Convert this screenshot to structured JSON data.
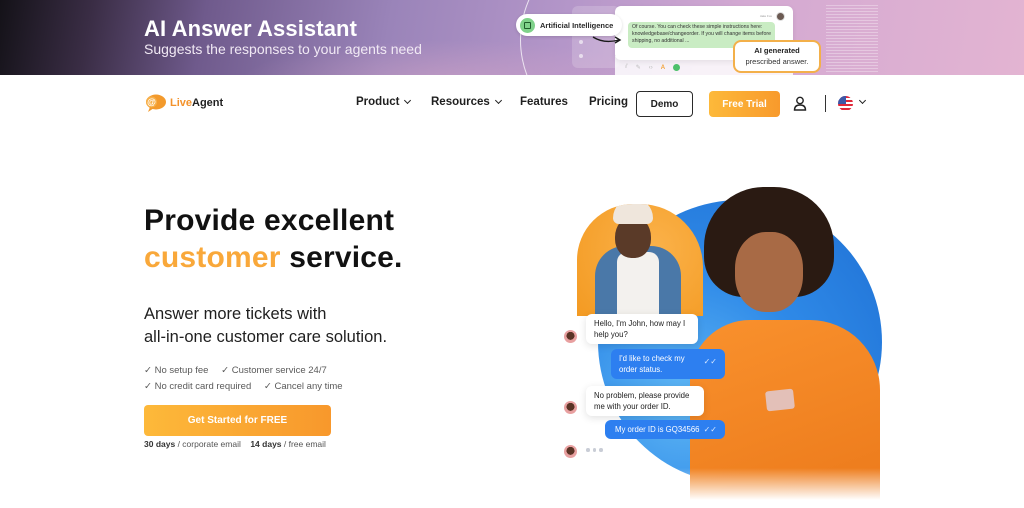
{
  "banner": {
    "title": "AI Answer Assistant",
    "subtitle": "Suggests the responses to your agents need",
    "ai_pill_label": "Artificial Intelligence",
    "chat_card": {
      "agent_name": "Jake Fox",
      "message": "Of course. You can check these simple instructions here: knowledgebase/changeorder. If you will change items before shipping, no additional ..."
    },
    "callout": {
      "title": "AI generated",
      "subtitle": "prescribed answer."
    }
  },
  "nav": {
    "logo_live": "Live",
    "logo_agent": "Agent",
    "items": [
      {
        "label": "Product",
        "has_dropdown": true
      },
      {
        "label": "Resources",
        "has_dropdown": true
      },
      {
        "label": "Features",
        "has_dropdown": false
      },
      {
        "label": "Pricing",
        "has_dropdown": false
      }
    ],
    "demo_label": "Demo",
    "trial_label": "Free Trial",
    "language": "en-US"
  },
  "hero": {
    "headline_line1": "Provide excellent",
    "headline_accent": "customer",
    "headline_rest": " service.",
    "subheadline_line1": "Answer more tickets with",
    "subheadline_line2": "all-in-one customer care solution.",
    "features": [
      [
        "✓ No setup fee",
        "✓ Customer service 24/7"
      ],
      [
        "✓ No credit card required",
        "✓ Cancel any time"
      ]
    ],
    "cta_label": "Get Started for FREE",
    "trial_note": {
      "corporate_days": "30 days",
      "corporate_text": " / corporate email",
      "free_days": "14 days",
      "free_text": " / free email"
    }
  },
  "chat": {
    "messages": [
      {
        "from": "agent",
        "text": "Hello, I'm John, how may I help you?"
      },
      {
        "from": "customer",
        "text": "I'd like to check my order status.",
        "status": "read"
      },
      {
        "from": "agent",
        "text": "No problem, please provide me with your order ID."
      },
      {
        "from": "customer",
        "text": "My order ID is GQ34566",
        "status": "read"
      }
    ],
    "typing_indicator": "..."
  },
  "colors": {
    "accent_orange": "#f9a83a",
    "chat_blue": "#2d7ff0",
    "text_dark": "#111111"
  }
}
